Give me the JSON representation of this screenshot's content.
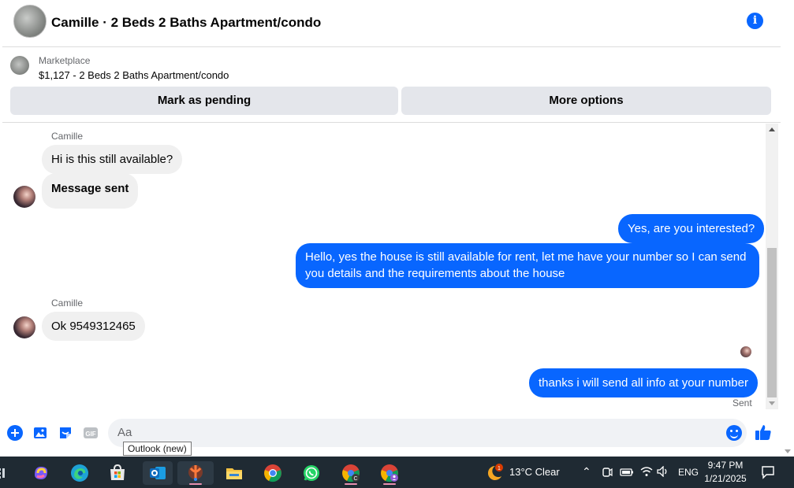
{
  "header": {
    "title": "Camille · 2 Beds 2 Baths Apartment/condo",
    "info_icon": "info-icon"
  },
  "listing": {
    "label": "Marketplace",
    "price_title": "$1,127 - 2 Beds 2 Baths Apartment/condo",
    "buttons": {
      "pending": "Mark as pending",
      "more": "More options"
    }
  },
  "messages": [
    {
      "sender": "Camille",
      "text": "Hi is this still available?",
      "direction": "incoming"
    },
    {
      "text": "Message sent",
      "direction": "incoming"
    },
    {
      "text": "Yes, are you interested?",
      "direction": "outgoing"
    },
    {
      "text_line1": "Hello, yes the house is still available for rent, let me have your number so I can send",
      "text_line2": "you details and the requirements about the house",
      "direction": "outgoing"
    },
    {
      "sender": "Camille",
      "text": "Ok 9549312465",
      "direction": "incoming"
    },
    {
      "text": "thanks i will send all info at your number",
      "direction": "outgoing",
      "status": "Sent"
    }
  ],
  "composer": {
    "placeholder": "Aa",
    "icons": [
      "plus-icon",
      "image-icon",
      "sticker-icon",
      "gif-icon",
      "emoji-icon",
      "like-icon"
    ],
    "gif_label": "GIF"
  },
  "tooltip": "Outlook (new)",
  "taskbar": {
    "weather_badge": "1",
    "weather": "13°C  Clear",
    "lang": "ENG",
    "time": "9:47 PM",
    "date": "1/21/2025",
    "chrome_badge": "C"
  },
  "colors": {
    "accent": "#0866ff",
    "incoming_bubble": "#f0f0f0",
    "taskbar": "#1f2a33"
  }
}
